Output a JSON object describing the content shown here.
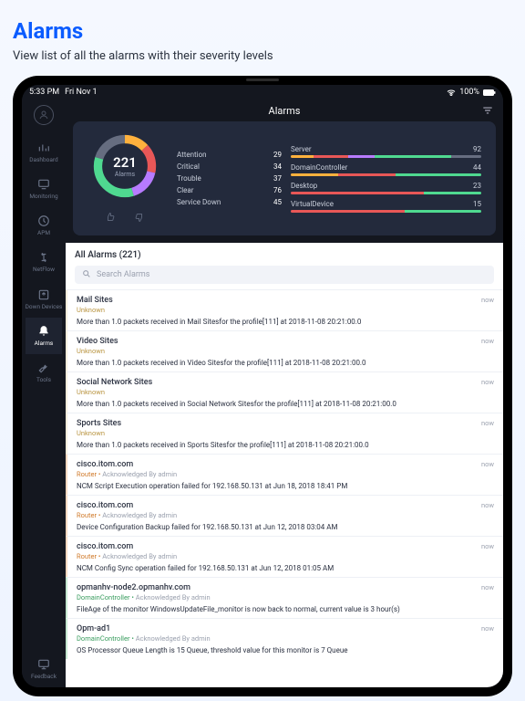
{
  "page": {
    "title": "Alarms",
    "subtitle": "View list of all the alarms with their severity levels"
  },
  "statusbar": {
    "time": "5:33 PM",
    "date": "Fri Nov 1",
    "battery": "100%"
  },
  "appbar": {
    "title": "Alarms"
  },
  "sidebar": {
    "items": [
      {
        "id": "dashboard",
        "label": "Dashboard"
      },
      {
        "id": "monitoring",
        "label": "Monitoring"
      },
      {
        "id": "apm",
        "label": "APM"
      },
      {
        "id": "netflow",
        "label": "NetFlow"
      },
      {
        "id": "down-devices",
        "label": "Down Devices"
      },
      {
        "id": "alarms",
        "label": "Alarms",
        "active": true
      },
      {
        "id": "tools",
        "label": "Tools"
      }
    ],
    "footer": {
      "id": "feedback",
      "label": "Feedback"
    }
  },
  "summary": {
    "total": {
      "count": 221,
      "label": "Alarms"
    },
    "severities": [
      {
        "name": "Attention",
        "count": 29,
        "color": "#ffb13d"
      },
      {
        "name": "Critical",
        "count": 34,
        "color": "#e85757"
      },
      {
        "name": "Trouble",
        "count": 37,
        "color": "#b77bff"
      },
      {
        "name": "Clear",
        "count": 76,
        "color": "#4fd990"
      },
      {
        "name": "Service Down",
        "count": 45,
        "color": "#666d80"
      }
    ],
    "categories": [
      {
        "name": "Server",
        "count": 92,
        "parts": [
          12,
          18,
          14,
          40,
          16
        ]
      },
      {
        "name": "DomainController",
        "count": 44,
        "parts": [
          25,
          30,
          0,
          45,
          0
        ]
      },
      {
        "name": "Desktop",
        "count": 23,
        "parts": [
          0,
          70,
          0,
          30,
          0
        ]
      },
      {
        "name": "VirtualDevice",
        "count": 15,
        "parts": [
          0,
          60,
          0,
          40,
          0
        ]
      }
    ]
  },
  "list": {
    "header": "All Alarms (221)",
    "search_placeholder": "Search Alarms",
    "items": [
      {
        "kind": "unknown",
        "title": "Mail Sites",
        "sub": "Unknown",
        "time": "now",
        "msg": "More than 1.0  packets received  in Mail Sitesfor the profile[111] at 2018-11-08 20:21:00.0"
      },
      {
        "kind": "unknown",
        "title": "Video Sites",
        "sub": "Unknown",
        "time": "now",
        "msg": "More than 1.0  packets received  in Video Sitesfor the profile[111] at 2018-11-08 20:21:00.0"
      },
      {
        "kind": "unknown",
        "title": "Social Network Sites",
        "sub": "Unknown",
        "time": "now",
        "msg": "More than 1.0  packets received  in Social Network Sitesfor the profile[111] at 2018-11-08 20:21:00.0"
      },
      {
        "kind": "unknown",
        "title": "Sports Sites",
        "sub": "Unknown",
        "time": "now",
        "msg": "More than 1.0  packets received  in Sports Sitesfor the profile[111] at 2018-11-08 20:21:00.0"
      },
      {
        "kind": "router",
        "title": "cisco.itom.com",
        "sub": "Router",
        "ack": "Acknowledged By admin",
        "time": "now",
        "msg": "NCM Script Execution operation failed for 192.168.50.131 at Jun 18, 2018 18:41 PM"
      },
      {
        "kind": "router",
        "title": "cisco.itom.com",
        "sub": "Router",
        "ack": "Acknowledged By admin",
        "time": "now",
        "msg": "Device Configuration Backup failed for 192.168.50.131 at Jun 12, 2018 03:04 AM"
      },
      {
        "kind": "router",
        "title": "cisco.itom.com",
        "sub": "Router",
        "ack": "Acknowledged By admin",
        "time": "now",
        "msg": "NCM Config Sync operation failed for 192.168.50.131 at Jun 12, 2018 01:05 AM"
      },
      {
        "kind": "dc",
        "title": "opmanhv-node2.opmanhv.com",
        "sub": "DomainController",
        "ack": "Acknowledged By admin",
        "time": "now",
        "msg": "FileAge of the monitor WindowsUpdateFile_monitor is now back to normal, current value is 3 hour(s)"
      },
      {
        "kind": "dc",
        "title": "Opm-ad1",
        "sub": "DomainController",
        "ack": "Acknowledged By admin",
        "time": "now",
        "msg": "OS Processor Queue Length is 15 Queue, threshold value for this monitor is 7 Queue"
      }
    ]
  },
  "chart_data": {
    "type": "pie",
    "title": "Alarms by severity",
    "total": 221,
    "series": [
      {
        "name": "Attention",
        "value": 29,
        "color": "#ffb13d"
      },
      {
        "name": "Critical",
        "value": 34,
        "color": "#e85757"
      },
      {
        "name": "Trouble",
        "value": 37,
        "color": "#b77bff"
      },
      {
        "name": "Clear",
        "value": 76,
        "color": "#4fd990"
      },
      {
        "name": "Service Down",
        "value": 45,
        "color": "#666d80"
      }
    ]
  }
}
